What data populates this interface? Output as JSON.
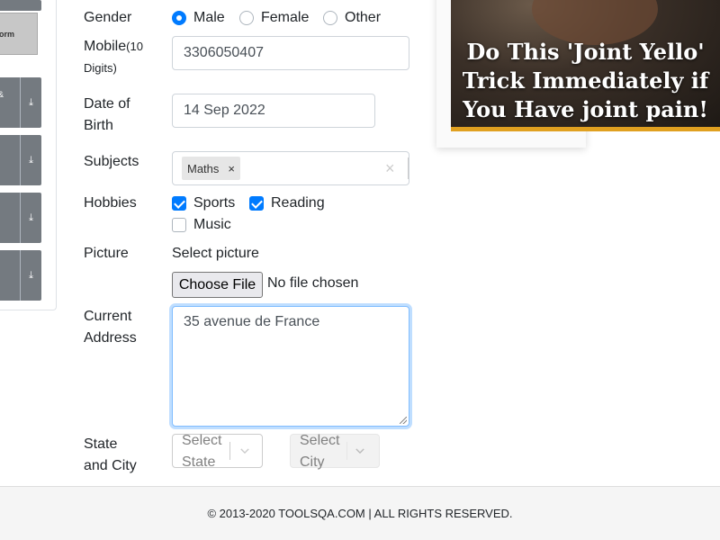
{
  "side_panel": {
    "light_item_label": "orm",
    "amp_glyph": "&",
    "download_icon": "download-icon",
    "download_glyph": "⤓"
  },
  "form": {
    "gender": {
      "label": "Gender",
      "options": [
        "Male",
        "Female",
        "Other"
      ],
      "selected": "Male"
    },
    "mobile": {
      "label": "Mobile",
      "label_suffix": "(10 Digits)",
      "value": "3306050407"
    },
    "dob": {
      "label_line1": "Date of",
      "label_line2": "Birth",
      "value": "14 Sep 2022"
    },
    "subjects": {
      "label": "Subjects",
      "tags": [
        "Maths"
      ],
      "tag_remove_glyph": "×",
      "clear_glyph": "×"
    },
    "hobbies": {
      "label": "Hobbies",
      "options": [
        {
          "label": "Sports",
          "checked": true
        },
        {
          "label": "Reading",
          "checked": true
        },
        {
          "label": "Music",
          "checked": false
        }
      ]
    },
    "picture": {
      "label": "Picture",
      "select_text": "Select picture",
      "button_label": "Choose File",
      "status": "No file chosen"
    },
    "address": {
      "label_line1": "Current",
      "label_line2": "Address",
      "value": "35 avenue de France"
    },
    "state_city": {
      "label_line1": "State",
      "label_line2": "and City",
      "state_placeholder_line1": "Select",
      "state_placeholder_line2": "State",
      "city_placeholder_line1": "Select",
      "city_placeholder_line2": "City"
    }
  },
  "ad": {
    "headline": "Do This 'Joint Yello' Trick Immediately if You Have joint pain!"
  },
  "footer": {
    "text": "© 2013-2020 TOOLSQA.COM | ALL RIGHTS RESERVED."
  },
  "colors": {
    "accent": "#007bff",
    "ad_bar": "#e0a020",
    "footer_bg": "#f5f5f5"
  }
}
